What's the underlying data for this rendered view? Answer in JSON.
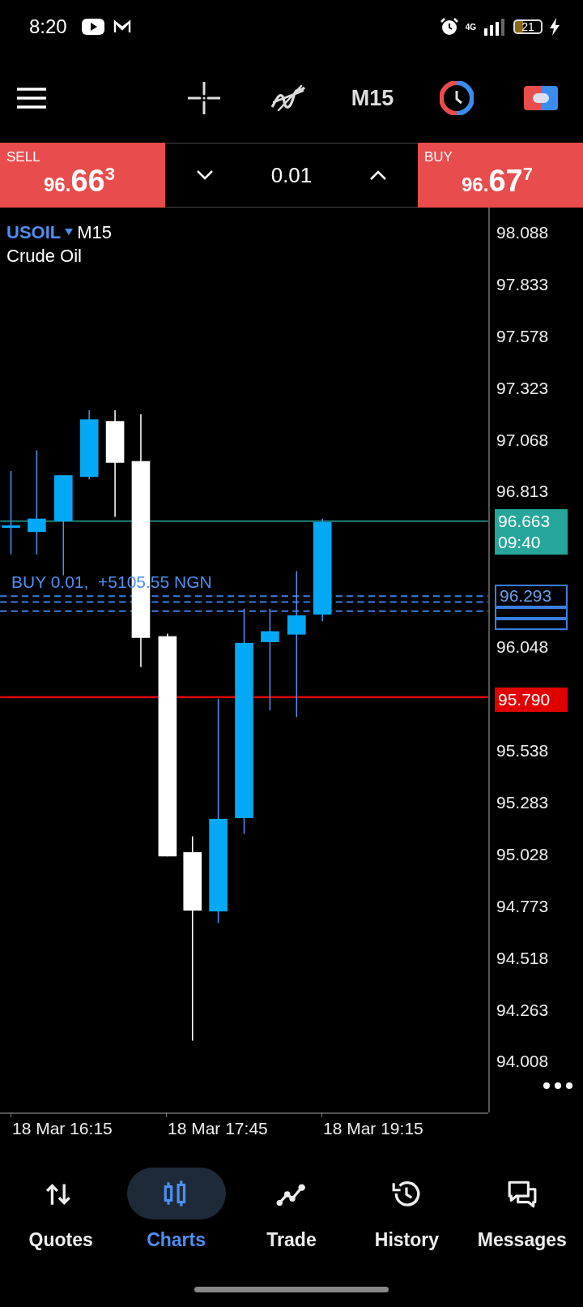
{
  "status_bar": {
    "time": "8:20",
    "network": "4G",
    "battery": "21"
  },
  "toolbar": {
    "timeframe": "M15"
  },
  "trade": {
    "sell": {
      "label": "SELL",
      "price_lead": "96.",
      "price_main": "66",
      "price_sup": "3"
    },
    "volume": "0.01",
    "buy": {
      "label": "BUY",
      "price_lead": "96.",
      "price_main": "67",
      "price_sup": "7"
    }
  },
  "chart": {
    "symbol": "USOIL",
    "timeframe": "M15",
    "instrument": "Crude Oil",
    "price_labels": [
      "98.088",
      "97.833",
      "97.578",
      "97.323",
      "97.068",
      "96.813",
      "96.048",
      "95.538",
      "95.283",
      "95.028",
      "94.773",
      "94.518",
      "94.263",
      "94.008"
    ],
    "bid_tag": {
      "price": "96.663",
      "countdown": "09:40"
    },
    "position_tag": "96.293",
    "stop_tag": "95.790",
    "position_label": "BUY 0.01,  +5105.55 NGN",
    "time_labels": [
      "18 Mar 16:15",
      "18 Mar 17:45",
      "18 Mar 19:15"
    ]
  },
  "nav": [
    {
      "label": "Quotes",
      "kind": "quotes",
      "selected": false
    },
    {
      "label": "Charts",
      "kind": "charts",
      "selected": true
    },
    {
      "label": "Trade",
      "kind": "trade",
      "selected": false
    },
    {
      "label": "History",
      "kind": "history",
      "selected": false
    },
    {
      "label": "Messages",
      "kind": "messages",
      "selected": false
    }
  ]
}
